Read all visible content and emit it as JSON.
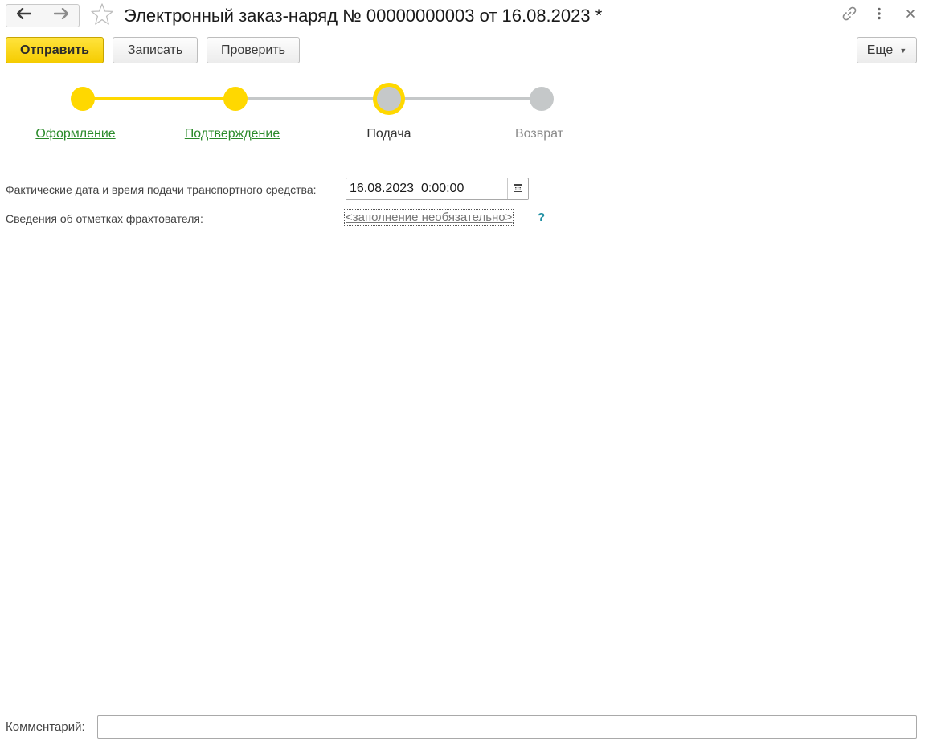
{
  "window": {
    "title": "Электронный заказ-наряд № 00000000003 от 16.08.2023 *",
    "icons": {
      "back": "arrow-left-icon",
      "forward": "arrow-right-icon",
      "favorite": "star-icon",
      "link": "link-icon",
      "menu": "more-vertical-icon",
      "close": "close-icon"
    }
  },
  "toolbar": {
    "send_label": "Отправить",
    "save_label": "Записать",
    "check_label": "Проверить",
    "more_label": "Еще"
  },
  "steps": [
    {
      "label": "Оформление",
      "state": "done"
    },
    {
      "label": "Подтверждение",
      "state": "done"
    },
    {
      "label": "Подача",
      "state": "current"
    },
    {
      "label": "Возврат",
      "state": "pending"
    }
  ],
  "form": {
    "datetime_label": "Фактические дата и время подачи транспортного средства:",
    "datetime_value": "16.08.2023  0:00:00",
    "notes_label": "Сведения об отметках фрахтователя:",
    "notes_link": "<заполнение необязательно>",
    "help_label": "?"
  },
  "comment": {
    "label": "Комментарий:",
    "value": ""
  },
  "colors": {
    "accent_yellow": "#ffd800",
    "inactive_gray": "#c5c8c9",
    "link_green": "#2a8a2a",
    "current_text": "#333333",
    "pending_text": "#8a8a8a",
    "help_teal": "#1f8fa3"
  }
}
